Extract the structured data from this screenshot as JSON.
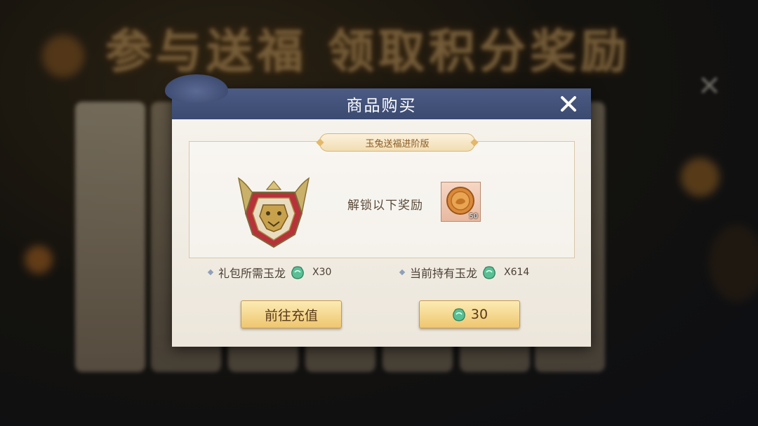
{
  "background": {
    "banner_text": "参与送福 领取积分奖励"
  },
  "dialog": {
    "title": "商品购买",
    "pack_name": "玉兔送福进阶版",
    "unlock_label": "解锁以下奖励",
    "reward_item": {
      "icon": "mooncake-coin-icon",
      "count": "50"
    },
    "required": {
      "label": "礼包所需玉龙",
      "qty": "X30"
    },
    "owned": {
      "label": "当前持有玉龙",
      "qty": "X614"
    },
    "recharge_button": "前往充值",
    "buy_button": {
      "price": "30",
      "icon": "jade-currency-icon"
    }
  },
  "colors": {
    "header": "#3b4a70",
    "button": "#eec66e",
    "jade": "#49b88a"
  }
}
